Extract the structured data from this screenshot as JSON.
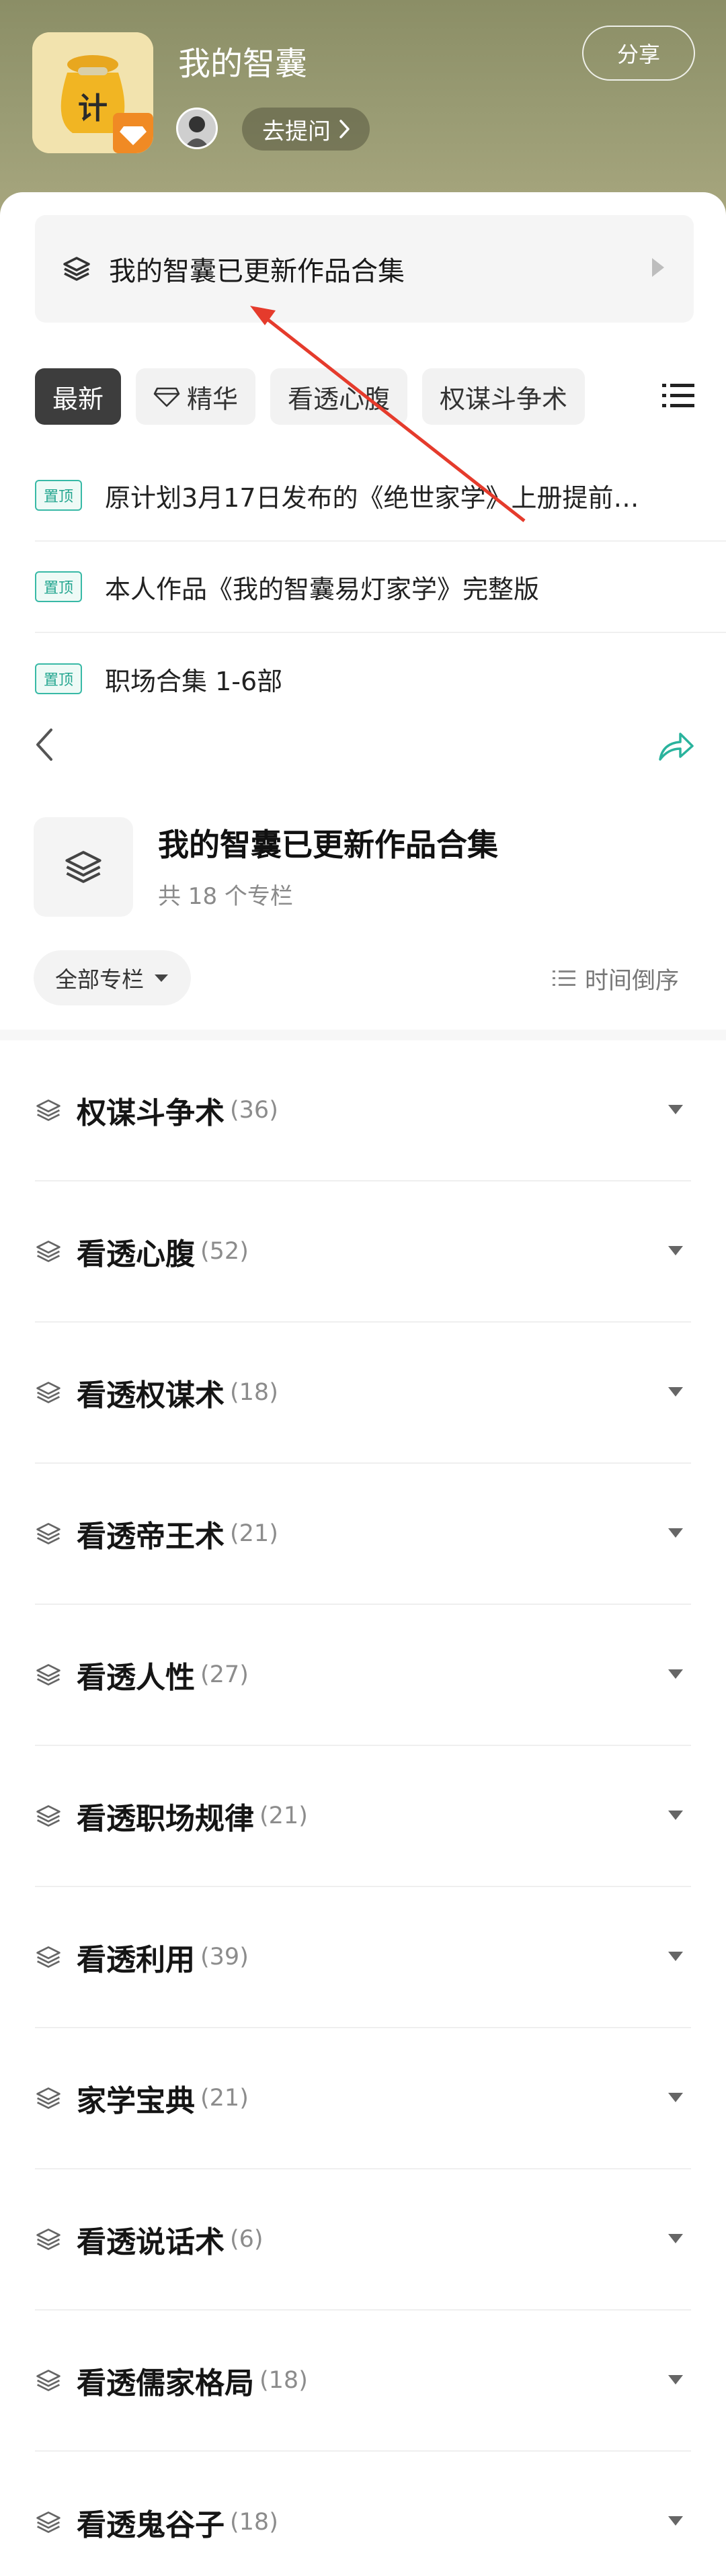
{
  "header": {
    "title": "我的智囊",
    "share_label": "分享",
    "ask_label": "去提问",
    "icon_char": "计"
  },
  "banner": {
    "text": "我的智囊已更新作品合集"
  },
  "tabs": [
    {
      "label": "最新",
      "active": true
    },
    {
      "label": "精华",
      "active": false
    },
    {
      "label": "看透心腹",
      "active": false
    },
    {
      "label": "权谋斗争术",
      "active": false
    }
  ],
  "pinned": {
    "badge": "置顶",
    "items": [
      "原计划3月17日发布的《绝世家学》上册提前…",
      "本人作品《我的智囊易灯家学》完整版",
      "职场合集 1-6部"
    ]
  },
  "collection": {
    "title": "我的智囊已更新作品合集",
    "count_text": "共 18 个专栏",
    "filter_label": "全部专栏",
    "sort_label": "时间倒序"
  },
  "columns": [
    {
      "name": "权谋斗争术",
      "count": "(36)"
    },
    {
      "name": "看透心腹",
      "count": "(52)"
    },
    {
      "name": "看透权谋术",
      "count": "(18)"
    },
    {
      "name": "看透帝王术",
      "count": "(21)"
    },
    {
      "name": "看透人性",
      "count": "(27)"
    },
    {
      "name": "看透职场规律",
      "count": "(21)"
    },
    {
      "name": "看透利用",
      "count": "(39)"
    },
    {
      "name": "家学宝典",
      "count": "(21)"
    },
    {
      "name": "看透说话术",
      "count": "(6)"
    },
    {
      "name": "看透儒家格局",
      "count": "(18)"
    },
    {
      "name": "看透鬼谷子",
      "count": "(18)"
    }
  ],
  "colors": {
    "accent_green": "#24a690",
    "header_bg": "#8b8e66",
    "annotation_red": "#e53b2c"
  }
}
